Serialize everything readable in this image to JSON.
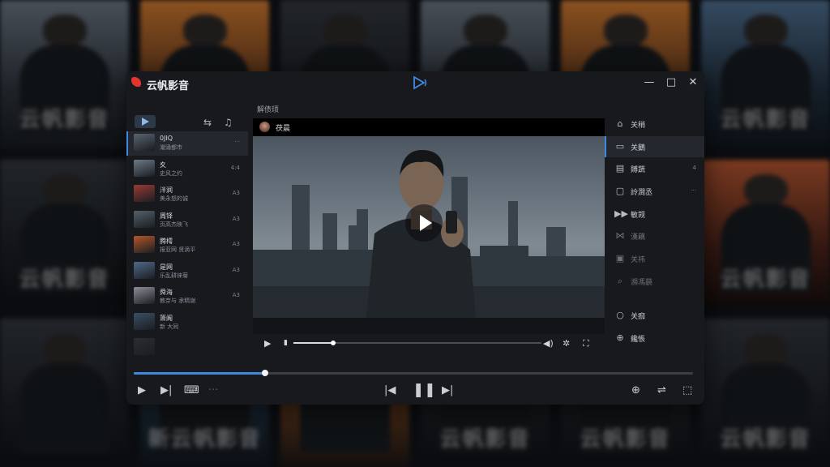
{
  "background_posters": [
    {
      "title": "云帆影音",
      "tone": "cool"
    },
    {
      "title": "",
      "tone": "warm"
    },
    {
      "title": "",
      "tone": "dark"
    },
    {
      "title": "",
      "tone": "cool"
    },
    {
      "title": "",
      "tone": "warm"
    },
    {
      "title": "云帆影音",
      "tone": "blue"
    },
    {
      "title": "云帆影音",
      "tone": "dark"
    },
    {
      "title": "",
      "tone": "dark"
    },
    {
      "title": "",
      "tone": "dark"
    },
    {
      "title": "",
      "tone": "dark"
    },
    {
      "title": "",
      "tone": "dark"
    },
    {
      "title": "云帆影音",
      "tone": "red"
    },
    {
      "title": "",
      "tone": "dark"
    },
    {
      "title": "新云帆影音",
      "tone": "blue"
    },
    {
      "title": "",
      "tone": "warm"
    },
    {
      "title": "云帆影音",
      "tone": "dark"
    },
    {
      "title": "云帆影音",
      "tone": "dark"
    },
    {
      "title": "云帆影音",
      "tone": "dark"
    }
  ],
  "app": {
    "title": "云帆影音",
    "accent": "#3f8ae0",
    "logo_color": "#e3342f"
  },
  "window_controls": {
    "minimize": "—",
    "maximize": "□",
    "close": "✕"
  },
  "playlist": {
    "items": [
      {
        "title": "0JIQ",
        "sub": "潮涌都市",
        "meta": "···",
        "active": true,
        "thumb": "#5a6470"
      },
      {
        "title": "夊",
        "sub": "史风之约",
        "meta": "4:4",
        "active": false,
        "thumb": "#6d7a86"
      },
      {
        "title": "泮涧",
        "sub": "美永怒的诚",
        "meta": "A3",
        "active": false,
        "thumb": "#9a3b34"
      },
      {
        "title": "周铎",
        "sub": "页高杰映飞",
        "meta": "A3",
        "active": false,
        "thumb": "#55606a"
      },
      {
        "title": "腾樗",
        "sub": "报亚网 贤滴平",
        "meta": "A3",
        "active": false,
        "thumb": "#b4572a"
      },
      {
        "title": "是网",
        "sub": "乐乱耕徕菊",
        "meta": "A3",
        "active": false,
        "thumb": "#4f6a8a"
      },
      {
        "title": "舜海",
        "sub": "教奈与 承精谢",
        "meta": "A3",
        "active": false,
        "thumb": "#8c8f96"
      },
      {
        "title": "箫阍",
        "sub": "新 大同",
        "meta": "",
        "active": false,
        "thumb": "#3b4f66"
      },
      {
        "title": "",
        "sub": "",
        "meta": "",
        "active": false,
        "thumb": "#2a2e34"
      }
    ]
  },
  "video": {
    "section_label": "解债顼",
    "user": "茯晨",
    "progress": 0.16
  },
  "right_menu": {
    "items": [
      {
        "icon": "⌂",
        "name": "home",
        "label": "关稍",
        "meta": "",
        "active": false,
        "dim": false
      },
      {
        "icon": "▭",
        "name": "screen",
        "label": "关鵝",
        "meta": "",
        "active": true,
        "dim": false
      },
      {
        "icon": "▤",
        "name": "list",
        "label": "賻蔬",
        "meta": "4",
        "active": false,
        "dim": false
      },
      {
        "icon": "▢",
        "name": "window",
        "label": "詅澗丞",
        "meta": "···",
        "active": false,
        "dim": false
      },
      {
        "icon": "▶▶",
        "name": "forward",
        "label": "敏觊",
        "meta": "",
        "active": false,
        "dim": false
      },
      {
        "icon": "⋈",
        "name": "bowtie",
        "label": "漢藕",
        "meta": "",
        "active": false,
        "dim": true
      },
      {
        "icon": "▣",
        "name": "subtitle",
        "label": "关祎",
        "meta": "",
        "active": false,
        "dim": true
      },
      {
        "icon": "⌕",
        "name": "search",
        "label": "瀕馮藐",
        "meta": "",
        "active": false,
        "dim": true
      },
      {
        "icon": "○",
        "name": "circle",
        "label": "关痂",
        "meta": "",
        "active": false,
        "dim": false
      },
      {
        "icon": "⊕",
        "name": "globe",
        "label": "饞悵",
        "meta": "",
        "active": false,
        "dim": false
      }
    ]
  },
  "player": {
    "progress": 0.235
  }
}
